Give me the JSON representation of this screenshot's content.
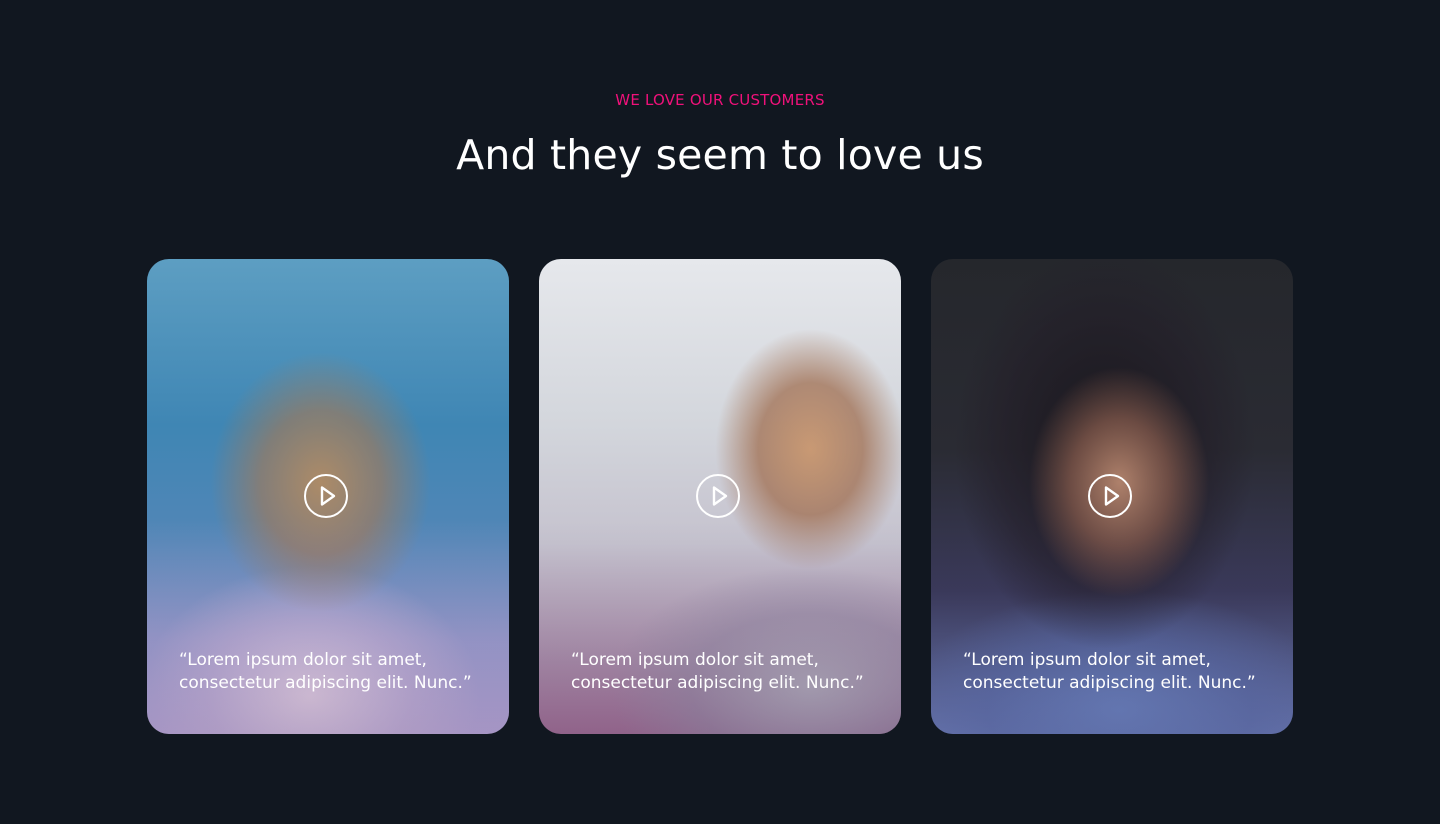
{
  "section": {
    "eyebrow": "WE LOVE OUR CUSTOMERS",
    "heading": "And they seem to love us"
  },
  "testimonials": [
    {
      "quote": "“Lorem ipsum dolor sit amet, consectetur adipiscing elit. Nunc.”",
      "play_icon": "play-icon"
    },
    {
      "quote": "“Lorem ipsum dolor sit amet, consectetur adipiscing elit. Nunc.”",
      "play_icon": "play-icon"
    },
    {
      "quote": "“Lorem ipsum dolor sit amet, consectetur adipiscing elit. Nunc.”",
      "play_icon": "play-icon"
    }
  ],
  "colors": {
    "background": "#111720",
    "accent": "#f0117a",
    "text": "#ffffff"
  }
}
